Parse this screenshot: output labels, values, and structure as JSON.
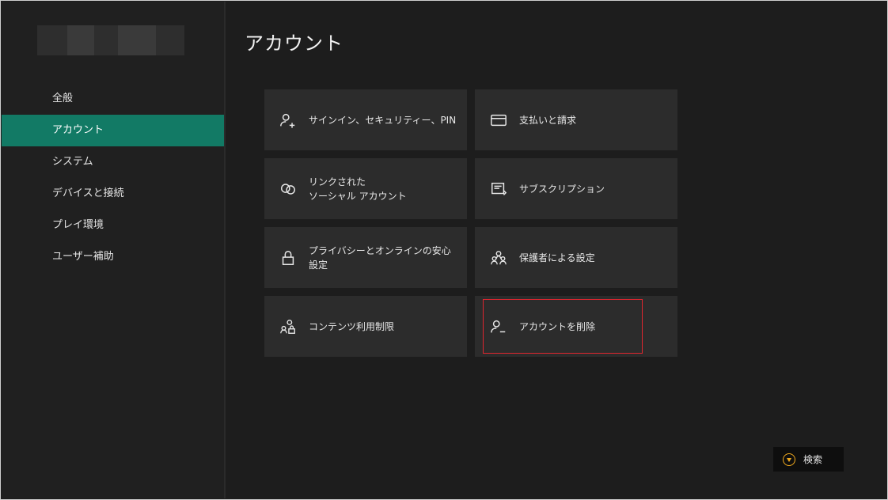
{
  "page": {
    "title": "アカウント"
  },
  "sidebar": {
    "items": [
      {
        "label": "全般",
        "active": false
      },
      {
        "label": "アカウント",
        "active": true
      },
      {
        "label": "システム",
        "active": false
      },
      {
        "label": "デバイスと接続",
        "active": false
      },
      {
        "label": "プレイ環境",
        "active": false
      },
      {
        "label": "ユーザー補助",
        "active": false
      }
    ]
  },
  "tiles": [
    {
      "label": "サインイン、セキュリティー、PIN",
      "icon": "person-plus-icon"
    },
    {
      "label": "支払いと請求",
      "icon": "credit-card-icon"
    },
    {
      "label": "リンクされた\nソーシャル アカウント",
      "icon": "linked-accounts-icon"
    },
    {
      "label": "サブスクリプション",
      "icon": "subscription-icon"
    },
    {
      "label": "プライバシーとオンラインの安心\n設定",
      "icon": "lock-icon"
    },
    {
      "label": "保護者による設定",
      "icon": "family-icon"
    },
    {
      "label": "コンテンツ利用制限",
      "icon": "content-restriction-icon"
    },
    {
      "label": "アカウントを削除",
      "icon": "person-remove-icon"
    }
  ],
  "search": {
    "label": "検索",
    "button_icon": "y-button-icon"
  },
  "colors": {
    "accent": "#127a65",
    "highlight": "#e0262f",
    "y_button": "#f0a91e",
    "background": "#1d1d1d",
    "tile": "#2c2c2c"
  }
}
